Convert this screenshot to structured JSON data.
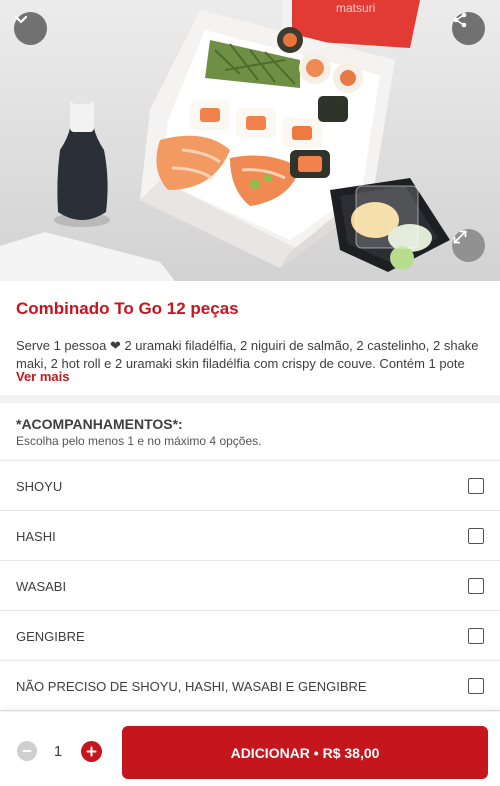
{
  "colors": {
    "brand": "#c4161c",
    "text": "#3e3e3e",
    "divider": "#e8e8e8",
    "icon_button_bg": "#505050"
  },
  "hero": {
    "icons": {
      "collapse": "chevron-down-icon",
      "share": "share-icon",
      "expand": "expand-icon"
    },
    "package_brand": "matsuri"
  },
  "product": {
    "title": "Combinado To Go 12 peças",
    "description": "Serve 1 pessoa ❤ 2 uramaki filadélfia, 2 niguiri de salmão, 2 castelinho, 2 shake maki, 2 hot roll e 2 uramaki skin filadélfia com crispy de couve. Contém 1 pote d...",
    "see_more_label": "Ver mais"
  },
  "group": {
    "title": "*ACOMPANHAMENTOS*:",
    "subtitle": "Escolha pelo menos 1 e no máximo 4 opções.",
    "options": [
      {
        "label": "SHOYU",
        "checked": false
      },
      {
        "label": "HASHI",
        "checked": false
      },
      {
        "label": "WASABI",
        "checked": false
      },
      {
        "label": "GENGIBRE",
        "checked": false
      },
      {
        "label": "NÃO PRECISO DE SHOYU, HASHI, WASABI E GENGIBRE",
        "checked": false
      }
    ]
  },
  "footer": {
    "quantity": "1",
    "add_button_label": "ADICIONAR • R$ 38,00",
    "icons": {
      "minus": "minus-icon",
      "plus": "plus-icon"
    }
  }
}
